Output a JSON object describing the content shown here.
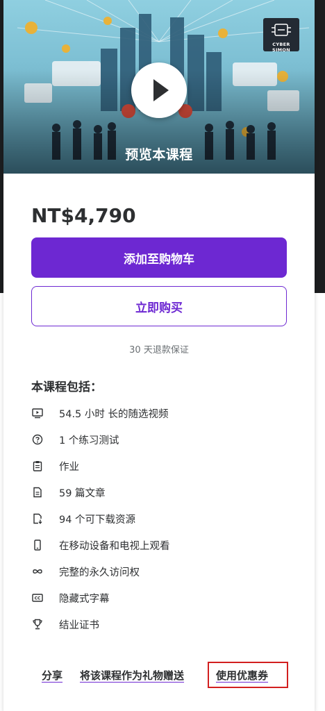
{
  "preview": {
    "label": "预览本课程",
    "logo_text": "CYBER SIMON"
  },
  "price": "NT$4,790",
  "buttons": {
    "add_to_cart": "添加至购物车",
    "buy_now": "立即购买"
  },
  "guarantee": "30 天退款保证",
  "includes": {
    "title": "本课程包括：",
    "items": [
      {
        "icon": "video-icon",
        "text": "54.5 小时 长的随选视频"
      },
      {
        "icon": "question-circle-icon",
        "text": "1 个练习测试"
      },
      {
        "icon": "clipboard-icon",
        "text": "作业"
      },
      {
        "icon": "file-text-icon",
        "text": "59 篇文章"
      },
      {
        "icon": "download-file-icon",
        "text": "94 个可下载资源"
      },
      {
        "icon": "mobile-device-icon",
        "text": "在移动设备和电视上观看"
      },
      {
        "icon": "infinity-icon",
        "text": "完整的永久访问权"
      },
      {
        "icon": "closed-captions-icon",
        "text": "隐藏式字幕"
      },
      {
        "icon": "trophy-icon",
        "text": "结业证书"
      }
    ]
  },
  "links": {
    "share": "分享",
    "gift": "将该课程作为礼物赠送",
    "coupon": "使用优惠券"
  },
  "colors": {
    "accent": "#6d28d2",
    "highlight_box": "#d21f1f"
  }
}
